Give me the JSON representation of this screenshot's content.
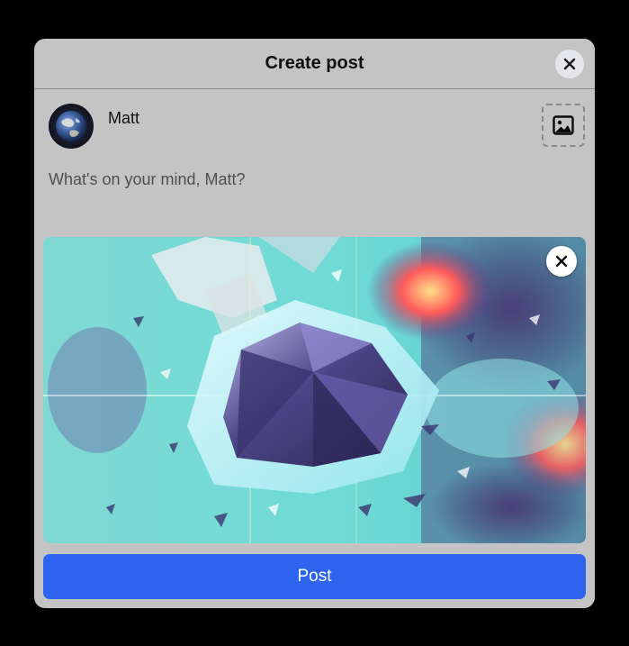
{
  "dialog": {
    "title": "Create post",
    "close_icon": "close-icon"
  },
  "user": {
    "name": "Matt",
    "avatar_icon": "earth-avatar"
  },
  "composer": {
    "placeholder": "What's on your mind, Matt?",
    "value": ""
  },
  "media": {
    "add_icon": "image-icon",
    "preview_image": "abstract-crystal-art",
    "remove_icon": "close-icon"
  },
  "actions": {
    "post_label": "Post"
  },
  "colors": {
    "modal_bg": "#c4c4c4",
    "post_button": "#2d64ed",
    "page_bg": "#000000"
  }
}
